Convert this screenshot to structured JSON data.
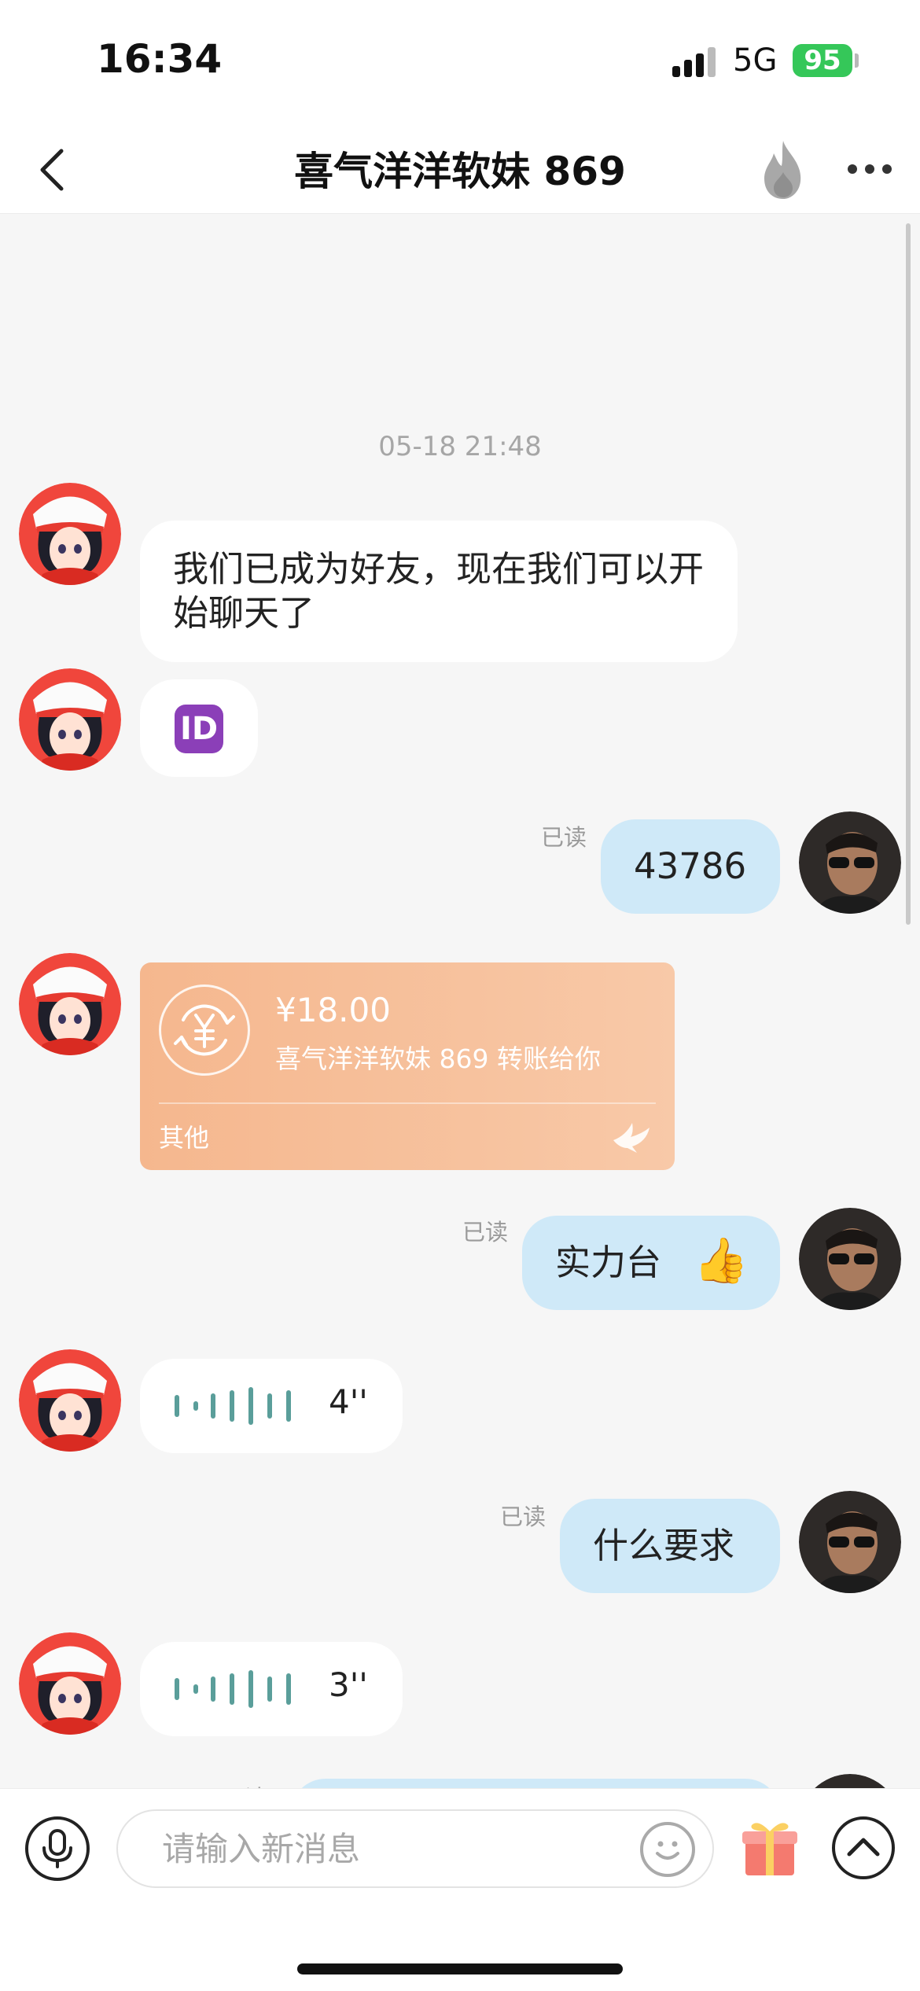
{
  "status_bar": {
    "time": "16:34",
    "network": "5G",
    "battery": "95"
  },
  "header": {
    "title": "喜气洋洋软妹 869"
  },
  "chat": {
    "timestamp": "05-18 21:48",
    "read_label": "已读",
    "messages": [
      {
        "sender": "contact",
        "type": "text",
        "text": "我们已成为好友，现在我们可以开始聊天了"
      },
      {
        "sender": "contact",
        "type": "emoji",
        "text": "ID"
      },
      {
        "sender": "me",
        "type": "text",
        "text": "43786",
        "status": "已读"
      },
      {
        "sender": "contact",
        "type": "transfer",
        "amount": "¥18.00",
        "description": "喜气洋洋软妹 869 转账给你",
        "footer": "其他"
      },
      {
        "sender": "me",
        "type": "text",
        "text": "实力台",
        "emoji": "👍",
        "status": "已读"
      },
      {
        "sender": "contact",
        "type": "voice",
        "duration": "4''"
      },
      {
        "sender": "me",
        "type": "text",
        "text": "什么要求",
        "status": "已读"
      },
      {
        "sender": "contact",
        "type": "voice",
        "duration": "3''"
      },
      {
        "sender": "me",
        "type": "text",
        "text": "",
        "status": "已读"
      }
    ]
  },
  "composer": {
    "placeholder": "请输入新消息"
  },
  "colors": {
    "own_bubble": "#cfe9f8",
    "contact_bubble": "#ffffff",
    "transfer_card": "#f5b78e",
    "voice_bars": "#5a9e9a",
    "battery": "#35c759"
  },
  "icons": {
    "back": "chevron-left-icon",
    "fire": "fire-icon",
    "more": "more-dots-icon",
    "mic": "microphone-icon",
    "emoji": "smiley-icon",
    "gift": "gift-icon",
    "expand": "chevron-up-icon",
    "transfer": "yen-exchange-icon",
    "transfer_brand": "dove-icon"
  }
}
